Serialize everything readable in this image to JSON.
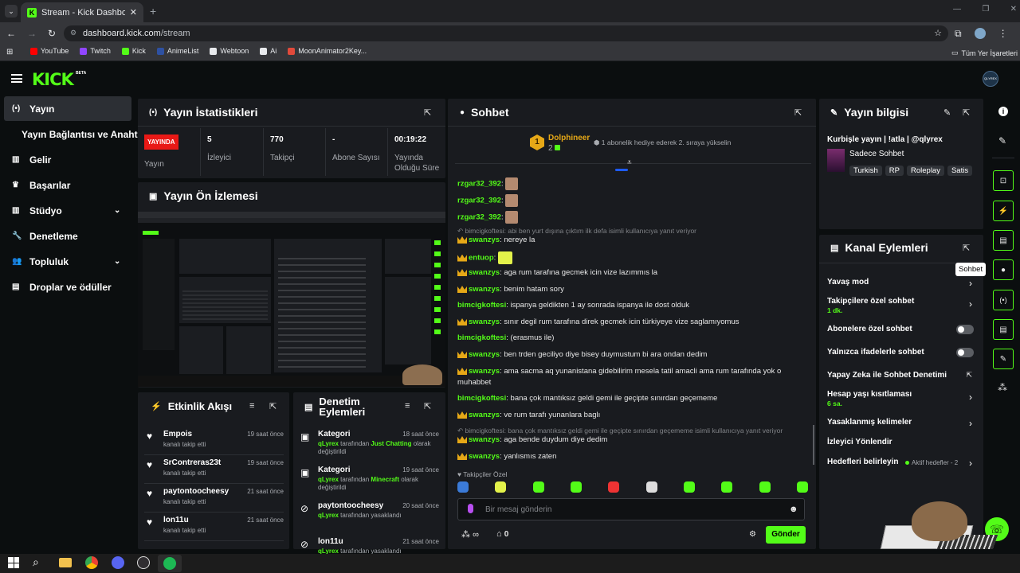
{
  "browser": {
    "tab_title": "Stream - Kick Dashboard",
    "url_host": "dashboard.kick.com",
    "url_path": "/stream",
    "bookmarks_all": "Tüm Yer İşaretleri",
    "bookmarks": [
      {
        "label": "YouTube",
        "color": "#ff0000"
      },
      {
        "label": "Twitch",
        "color": "#9146ff"
      },
      {
        "label": "Kick",
        "color": "#53fc18"
      },
      {
        "label": "AnimeList",
        "color": "#2e51a2"
      },
      {
        "label": "Webtoon",
        "color": "#e8eaed"
      },
      {
        "label": "Ai",
        "color": "#e8eaed"
      },
      {
        "label": "MoonAnimator2Key...",
        "color": "#e14a3b"
      }
    ]
  },
  "header": {
    "logo": "KICK",
    "beta": "BETA",
    "avatar": "QLYREX"
  },
  "sidebar": {
    "items": [
      {
        "label": "Yayın"
      },
      {
        "label": "Yayın Bağlantısı ve Anahtarı"
      },
      {
        "label": "Gelir"
      },
      {
        "label": "Başarılar"
      },
      {
        "label": "Stüdyo"
      },
      {
        "label": "Denetleme"
      },
      {
        "label": "Topluluk"
      },
      {
        "label": "Droplar ve ödüller"
      }
    ]
  },
  "stats": {
    "title": "Yayın İstatistikleri",
    "live_badge": "YAYINDA",
    "live_label": "Yayın",
    "cells": [
      {
        "value": "5",
        "label": "İzleyici"
      },
      {
        "value": "770",
        "label": "Takipçi"
      },
      {
        "value": "-",
        "label": "Abone Sayısı"
      },
      {
        "value": "00:19:22",
        "label": "Yayında Olduğu Süre"
      }
    ]
  },
  "preview": {
    "title": "Yayın Ön İzlemesi"
  },
  "activity": {
    "title": "Etkinlik Akışı",
    "items": [
      {
        "name": "Empois",
        "desc": "kanalı takip etti",
        "time": "19 saat önce"
      },
      {
        "name": "SrContreras23t",
        "desc": "kanalı takip etti",
        "time": "19 saat önce"
      },
      {
        "name": "paytontoocheesy",
        "desc": "kanalı takip etti",
        "time": "21 saat önce"
      },
      {
        "name": "lon11u",
        "desc": "kanalı takip etti",
        "time": "21 saat önce"
      }
    ]
  },
  "moderation": {
    "title": "Denetim Eylemleri",
    "items": [
      {
        "name": "Kategori",
        "who": "qLyrex",
        "mid": " tarafından ",
        "hl": "Just Chatting",
        "rest": " olarak değiştirildi",
        "time": "18 saat önce"
      },
      {
        "name": "Kategori",
        "who": "qLyrex",
        "mid": " tarafından ",
        "hl": "Minecraft",
        "rest": " olarak değiştirildi",
        "time": "19 saat önce"
      },
      {
        "name": "paytontoocheesy",
        "who": "qLyrex",
        "mid": " tarafından yasaklandı",
        "hl": "",
        "rest": "",
        "time": "20 saat önce"
      },
      {
        "name": "lon11u",
        "who": "qLyrex",
        "mid": " tarafından yasaklandı",
        "hl": "",
        "rest": "",
        "time": "21 saat önce"
      }
    ]
  },
  "chat": {
    "title": "Sohbet",
    "pinned_user": "Dolphineer",
    "pinned_rank": "1",
    "pinned_count": "2",
    "pinned_text": "1 abonelik hediye ederek 2. sıraya yükselin",
    "messages": [
      {
        "user": "rzgar32_392",
        "text": "",
        "color": "#53fc18",
        "crown": false,
        "emote": "face"
      },
      {
        "user": "rzgar32_392",
        "text": "",
        "color": "#53fc18",
        "crown": false,
        "emote": "face"
      },
      {
        "user": "rzgar32_392",
        "text": "",
        "color": "#53fc18",
        "crown": false,
        "emote": "face"
      },
      {
        "reply": "bimcigkoftesi: abi ben yurt dışına çıktım ilk defa  isimli kullanıcıya yanıt veriyor"
      },
      {
        "user": "swanzys",
        "text": "nereye la",
        "color": "#53fc18",
        "crown": true
      },
      {
        "user": "entuop",
        "text": "",
        "color": "#53fc18",
        "crown": true,
        "emote": "cat"
      },
      {
        "user": "swanzys",
        "text": "aga rum tarafına gecmek icin vize lazımmıs la",
        "color": "#53fc18",
        "crown": true
      },
      {
        "user": "swanzys",
        "text": "benim hatam sory",
        "color": "#53fc18",
        "crown": true
      },
      {
        "user": "bimcigkoftesi",
        "text": "ispanya geldikten 1 ay sonrada ispanya ile dost olduk",
        "color": "#53fc18",
        "crown": false
      },
      {
        "user": "swanzys",
        "text": "sınır degil rum tarafına direk gecmek icin türkiyeye vize saglamıyomus",
        "color": "#53fc18",
        "crown": true
      },
      {
        "user": "bimcigkoftesi",
        "text": "(erasmus ile)",
        "color": "#53fc18",
        "crown": false
      },
      {
        "user": "swanzys",
        "text": "ben trden geciliyo diye bisey duymustum bi ara ondan dedim",
        "color": "#53fc18",
        "crown": true
      },
      {
        "user": "swanzys",
        "text": "ama sacma aq yunanistana gidebilirim mesela tatil amacli ama rum tarafında yok o",
        "text2": "muhabbet",
        "color": "#53fc18",
        "crown": true
      },
      {
        "user": "bimcigkoftesi",
        "text": "bana çok mantıksız geldi gemi ile geçipte sınırdan geçememe",
        "color": "#53fc18",
        "crown": false
      },
      {
        "user": "swanzys",
        "text": "ve rum tarafı yunanlara baglı",
        "color": "#53fc18",
        "crown": true
      },
      {
        "reply": "bimcigkoftesi: bana çok mantıksız geldi gemi ile geçipte sınırdan geçememe isimli kullanıcıya yanıt veriyor"
      },
      {
        "user": "swanzys",
        "text": "aga bende duydum diye dedim",
        "color": "#53fc18",
        "crown": true
      },
      {
        "user": "swanzys",
        "text": "yanlısmıs zaten",
        "color": "#53fc18",
        "crown": true
      }
    ],
    "followers_only": "Takipçiler Özel",
    "input_placeholder": "Bir mesaj gönderin",
    "send": "Gönder",
    "infinity": "∞",
    "gift_count": "0",
    "tooltip": "Sohbet"
  },
  "info": {
    "title": "Yayın bilgisi",
    "stream_title": "Kurbişle yayın | !atla | @qlyrex",
    "category": "Sadece Sohbet",
    "tags": [
      "Turkish",
      "RP",
      "Roleplay",
      "Satis"
    ]
  },
  "actions": {
    "title": "Kanal Eylemleri",
    "items": [
      {
        "label": "Yavaş mod",
        "sub": "",
        "kind": "arrow"
      },
      {
        "label": "Takipçilere özel sohbet",
        "sub": "1 dk.",
        "kind": "arrow"
      },
      {
        "label": "Abonelere özel sohbet",
        "sub": "",
        "kind": "toggle"
      },
      {
        "label": "Yalnızca ifadelerle sohbet",
        "sub": "",
        "kind": "toggle"
      },
      {
        "label": "Yapay Zeka ile Sohbet Denetimi",
        "sub": "",
        "kind": "ext"
      },
      {
        "label": "Hesap yaşı kısıtlaması",
        "sub": "6 sa.",
        "kind": "arrow"
      },
      {
        "label": "Yasaklanmış kelimeler",
        "sub": "",
        "kind": "arrow"
      },
      {
        "label": "İzleyici Yönlendir",
        "sub": "",
        "kind": "none"
      },
      {
        "label": "Hedefleri belirleyin",
        "sub": "",
        "kind": "goal",
        "extra": "Aktif hedefler - 2"
      }
    ]
  }
}
